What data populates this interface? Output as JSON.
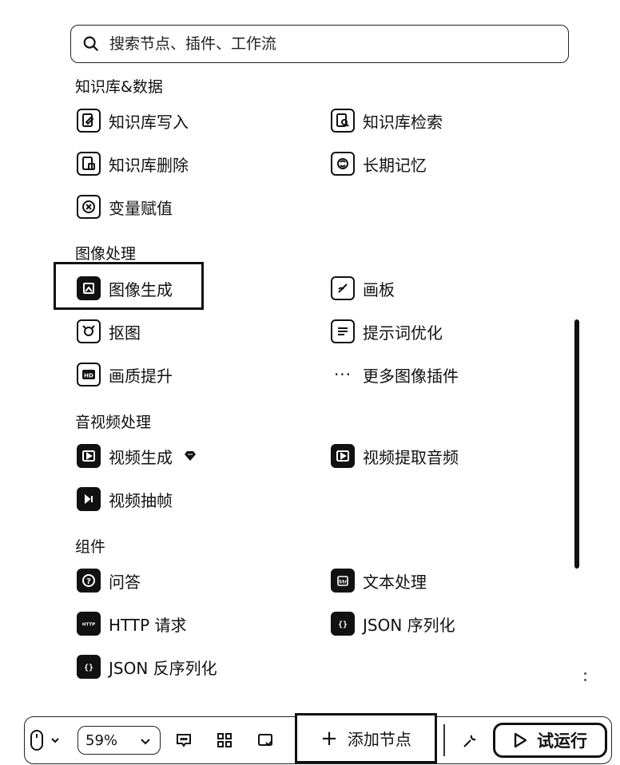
{
  "search": {
    "placeholder": "搜索节点、插件、工作流"
  },
  "sections": [
    {
      "title": "知识库&数据",
      "items": [
        {
          "label": "知识库写入",
          "icon": "kb-write-icon"
        },
        {
          "label": "知识库检索",
          "icon": "kb-search-icon"
        },
        {
          "label": "知识库删除",
          "icon": "kb-delete-icon"
        },
        {
          "label": "长期记忆",
          "icon": "memory-icon"
        },
        {
          "label": "变量赋值",
          "icon": "variable-assign-icon"
        }
      ]
    },
    {
      "title": "图像处理",
      "items": [
        {
          "label": "图像生成",
          "icon": "image-generate-icon"
        },
        {
          "label": "画板",
          "icon": "canvas-icon"
        },
        {
          "label": "抠图",
          "icon": "cutout-icon"
        },
        {
          "label": "提示词优化",
          "icon": "prompt-optimize-icon"
        },
        {
          "label": "画质提升",
          "icon": "hd-icon"
        },
        {
          "label": "更多图像插件",
          "icon": "more-dots-icon"
        }
      ]
    },
    {
      "title": "音视频处理",
      "items": [
        {
          "label": "视频生成",
          "icon": "video-generate-icon"
        },
        {
          "label": "视频提取音频",
          "icon": "video-audio-icon"
        },
        {
          "label": "视频抽帧",
          "icon": "video-frame-icon"
        }
      ]
    },
    {
      "title": "组件",
      "items": [
        {
          "label": "问答",
          "icon": "question-icon"
        },
        {
          "label": "文本处理",
          "icon": "text-process-icon"
        },
        {
          "label": "HTTP 请求",
          "icon": "http-icon"
        },
        {
          "label": "JSON 序列化",
          "icon": "json-serialize-icon"
        },
        {
          "label": "JSON 反序列化",
          "icon": "json-deserialize-icon"
        }
      ]
    }
  ],
  "toolbar": {
    "zoom": "59%",
    "add_node": "添加节点",
    "run": "试运行"
  }
}
